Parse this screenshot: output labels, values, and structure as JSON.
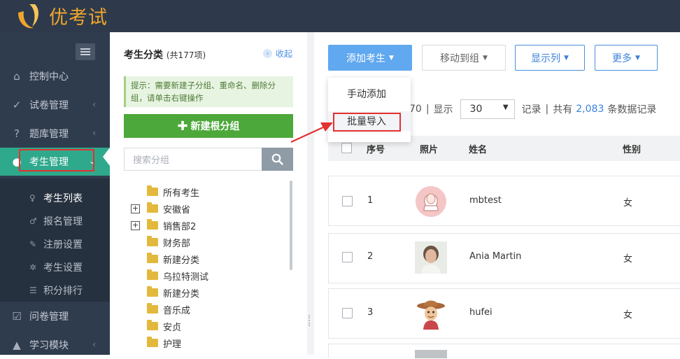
{
  "app": {
    "logo_text": "优考试",
    "brand_color": "#f0a52c"
  },
  "sidebar": {
    "items": [
      {
        "label": "控制中心",
        "icon": "home-icon"
      },
      {
        "label": "试卷管理",
        "icon": "check-circle-icon",
        "expandable": true
      },
      {
        "label": "题库管理",
        "icon": "question-circle-icon",
        "expandable": true
      },
      {
        "label": "考生管理",
        "icon": "user-icon",
        "expandable": true,
        "active": true
      },
      {
        "label": "问卷管理",
        "icon": "checkbox-icon"
      },
      {
        "label": "学习模块",
        "icon": "graduation-cap-icon",
        "expandable": true
      }
    ],
    "sub_items": [
      {
        "label": "考生列表",
        "icon": "user-outline-icon",
        "current": true
      },
      {
        "label": "报名管理",
        "icon": "user-plus-icon"
      },
      {
        "label": "注册设置",
        "icon": "wrench-icon"
      },
      {
        "label": "考生设置",
        "icon": "gear-icon"
      },
      {
        "label": "积分排行",
        "icon": "list-icon"
      }
    ]
  },
  "category_panel": {
    "title": "考生分类",
    "count_text": "(共177项)",
    "collapse_label": "收起",
    "hint": "提示：需要新建子分组、重命名、删除分组，请单击右键操作",
    "new_root_label": "新建根分组",
    "search_placeholder": "搜索分组",
    "tree": [
      {
        "label": "所有考生",
        "expandable": false
      },
      {
        "label": "安徽省",
        "expandable": true
      },
      {
        "label": "销售部2",
        "expandable": true
      },
      {
        "label": "财务部",
        "expandable": false
      },
      {
        "label": "新建分类",
        "expandable": false
      },
      {
        "label": "乌拉特测试",
        "expandable": false
      },
      {
        "label": "新建分类",
        "expandable": false
      },
      {
        "label": "音乐成",
        "expandable": false
      },
      {
        "label": "安贞",
        "expandable": false
      },
      {
        "label": "护理",
        "expandable": false
      }
    ]
  },
  "toolbar": {
    "add_label": "添加考生",
    "move_label": "移动到组",
    "columns_label": "显示列",
    "more_label": "更多",
    "add_menu": [
      "手动添加",
      "批量导入"
    ]
  },
  "pager": {
    "partial": "70",
    "sep1": "|",
    "show_label": "显示",
    "page_size": "30",
    "records_label": "记录",
    "sep2": "|",
    "total_prefix": "共有",
    "total": "2,083",
    "total_suffix": "条数据记录"
  },
  "table": {
    "headers": [
      "序号",
      "照片",
      "姓名",
      "性别"
    ],
    "rows": [
      {
        "no": "1",
        "name": "mbtest",
        "gender": "女",
        "photo": "default-female-avatar"
      },
      {
        "no": "2",
        "name": "Ania Martin",
        "gender": "女",
        "photo": "woman-portrait"
      },
      {
        "no": "3",
        "name": "hufei",
        "gender": "女",
        "photo": "cowboy-cartoon"
      }
    ]
  }
}
